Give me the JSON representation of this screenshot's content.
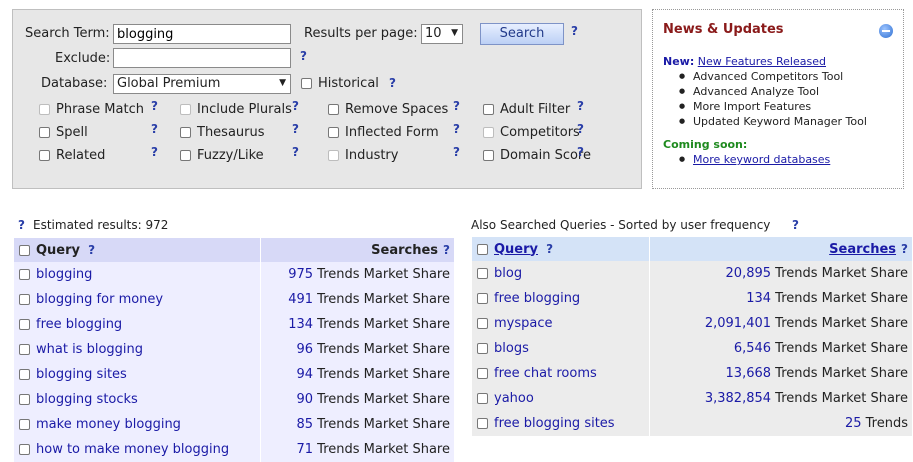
{
  "search": {
    "term_label": "Search Term:",
    "term_value": "blogging",
    "results_label": "Results per page:",
    "results_value": "10",
    "search_button": "Search",
    "exclude_label": "Exclude:",
    "exclude_value": "",
    "database_label": "Database:",
    "database_value": "Global Premium",
    "historical_label": "Historical",
    "help": "?",
    "options": [
      {
        "label": "Phrase Match",
        "enabled": false
      },
      {
        "label": "Include Plurals",
        "enabled": false
      },
      {
        "label": "Remove Spaces",
        "enabled": true
      },
      {
        "label": "Adult Filter",
        "enabled": true
      },
      {
        "label": "Spell",
        "enabled": true
      },
      {
        "label": "Thesaurus",
        "enabled": true
      },
      {
        "label": "Inflected Form",
        "enabled": true
      },
      {
        "label": "Competitors",
        "enabled": false
      },
      {
        "label": "Related",
        "enabled": true
      },
      {
        "label": "Fuzzy/Like",
        "enabled": true
      },
      {
        "label": "Industry",
        "enabled": false
      },
      {
        "label": "Domain Score",
        "enabled": true
      }
    ]
  },
  "news": {
    "title": "News & Updates",
    "new_label": "New:",
    "new_link": "New Features Released",
    "items": [
      "Advanced Competitors Tool",
      "Advanced Analyze Tool",
      "More Import Features",
      "Updated Keyword Manager Tool"
    ],
    "coming_label": "Coming soon:",
    "coming_link": "More keyword databases"
  },
  "results": {
    "estimated_label": "Estimated results: 972",
    "header_query": "Query",
    "header_searches": "Searches",
    "rows": [
      {
        "query": "blogging",
        "count": "975",
        "links": "Trends Market Share"
      },
      {
        "query": "blogging for money",
        "count": "491",
        "links": "Trends Market Share"
      },
      {
        "query": "free blogging",
        "count": "134",
        "links": "Trends Market Share"
      },
      {
        "query": "what is blogging",
        "count": "96",
        "links": "Trends Market Share"
      },
      {
        "query": "blogging sites",
        "count": "94",
        "links": "Trends Market Share"
      },
      {
        "query": "blogging stocks",
        "count": "90",
        "links": "Trends Market Share"
      },
      {
        "query": "make money blogging",
        "count": "85",
        "links": "Trends Market Share"
      },
      {
        "query": "how to make money blogging",
        "count": "71",
        "links": "Trends Market Share"
      }
    ]
  },
  "also": {
    "title": "Also Searched Queries - Sorted by user frequency",
    "header_query": "Query",
    "header_searches": "Searches",
    "rows": [
      {
        "query": "blog",
        "count": "20,895",
        "links": "Trends Market Share"
      },
      {
        "query": "free blogging",
        "count": "134",
        "links": "Trends Market Share"
      },
      {
        "query": "myspace",
        "count": "2,091,401",
        "links": "Trends Market Share"
      },
      {
        "query": "blogs",
        "count": "6,546",
        "links": "Trends Market Share"
      },
      {
        "query": "free chat rooms",
        "count": "13,668",
        "links": "Trends Market Share"
      },
      {
        "query": "yahoo",
        "count": "3,382,854",
        "links": "Trends Market Share"
      },
      {
        "query": "free blogging sites",
        "count": "25",
        "links": "Trends"
      }
    ]
  }
}
